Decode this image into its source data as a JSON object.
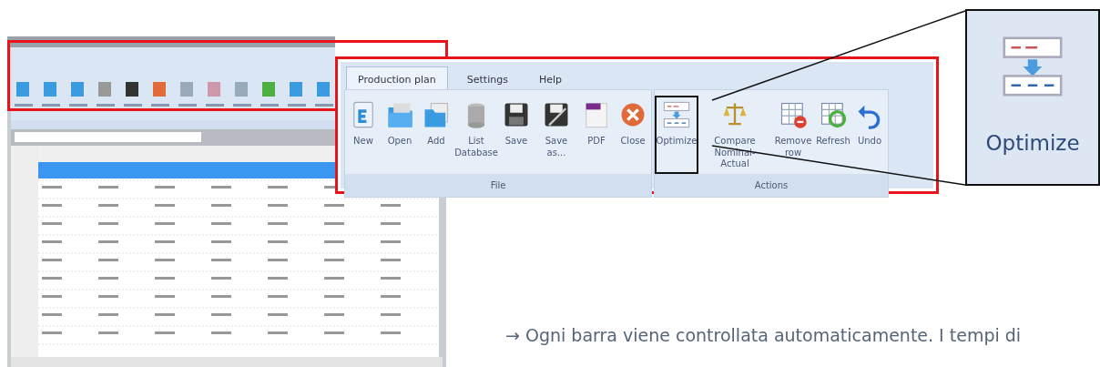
{
  "ribbon": {
    "tabs": [
      {
        "label": "Production plan",
        "selected": true
      },
      {
        "label": "Settings",
        "selected": false
      },
      {
        "label": "Help",
        "selected": false
      }
    ],
    "groups": [
      {
        "label": "File",
        "buttons": [
          {
            "label": "New",
            "highlighted": false
          },
          {
            "label": "Open",
            "highlighted": false
          },
          {
            "label": "Add",
            "highlighted": false
          },
          {
            "label": "List Database",
            "highlighted": false
          },
          {
            "label": "Save",
            "highlighted": false
          },
          {
            "label": "Save as...",
            "highlighted": false
          },
          {
            "label": "PDF",
            "highlighted": false
          },
          {
            "label": "Close",
            "highlighted": false
          }
        ]
      },
      {
        "label": "Actions",
        "buttons": [
          {
            "label": "Optimize",
            "highlighted": true
          },
          {
            "label": "Compare Nominal-Actual",
            "highlighted": false
          },
          {
            "label": "Remove row",
            "highlighted": false
          },
          {
            "label": "Refresh",
            "highlighted": false
          },
          {
            "label": "Undo",
            "highlighted": false
          }
        ]
      }
    ]
  },
  "zoom_inset": {
    "label": "Optimize"
  },
  "caption": "→ Ogni barra viene controllata automaticamente. I tempi di"
}
